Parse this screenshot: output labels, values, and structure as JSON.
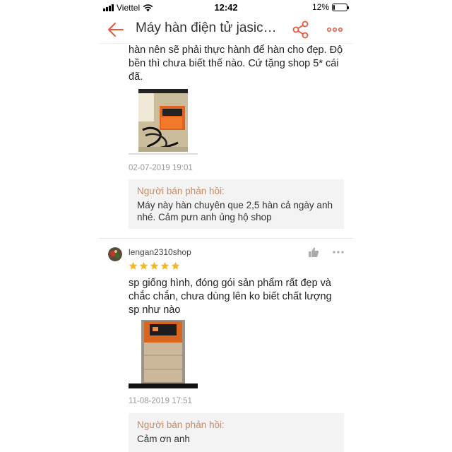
{
  "status_bar": {
    "carrier": "Viettel",
    "time": "12:42",
    "battery_percent": "12%",
    "battery_level": 0.12
  },
  "nav": {
    "title": "Máy hàn điện tử jasic…",
    "back_icon": "back-arrow-icon",
    "share_icon": "share-icon",
    "more_icon": "more-icon",
    "accent_color": "#e8573c"
  },
  "reviews": [
    {
      "text": "hàn nên sẽ phải thực hành để hàn cho đẹp. Độ bền thì chưa biết thế nào. Cứ tặng shop 5* cái đã.",
      "date": "02-07-2019 19:01",
      "seller_label": "Người bán phản hồi:",
      "seller_reply": "Máy này hàn chuyên que 2,5 hàn cả ngày anh nhé. Cảm pưn anh ủng hộ shop"
    },
    {
      "username": "lengan2310shop",
      "rating": 5,
      "text": "sp giống hình, đóng gói sản phẩm rất đẹp và chắc chắn, chưa dùng lên ko biết chất lượng sp như nào",
      "date": "11-08-2019 17:51",
      "seller_label": "Người bán phản hồi:",
      "seller_reply": "Cảm ơn anh"
    }
  ],
  "colors": {
    "star": "#f5b622",
    "seller_label": "#c88a64",
    "date": "#999999"
  }
}
